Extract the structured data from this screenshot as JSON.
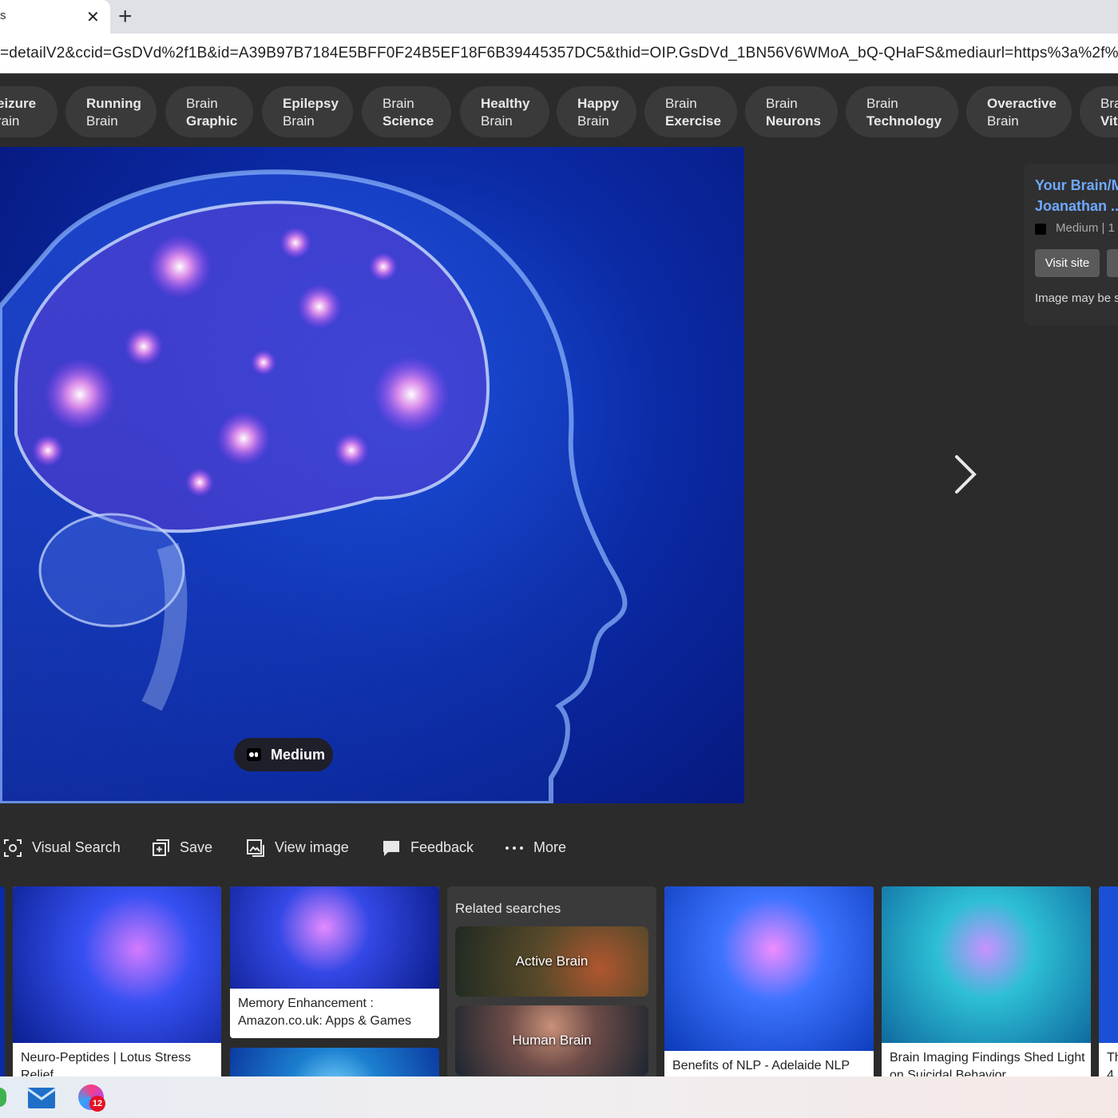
{
  "browser": {
    "tab_title": "s",
    "tab_close": "✕",
    "new_tab": "+",
    "url": "=detailV2&ccid=GsDVd%2f1B&id=A39B97B7184E5BFF0F24B5EF18F6B39445357DC5&thid=OIP.GsDVd_1BN56V6WMoA_bQ-QHaFS&mediaurl=https%3a%2f%2fmiro.medium.co"
  },
  "chips": [
    {
      "line1": "eizure",
      "line2": "rain",
      "bold": "line1"
    },
    {
      "line1": "Running",
      "line2": "Brain",
      "bold": "line1"
    },
    {
      "line1": "Brain",
      "line2": "Graphic",
      "bold": "line2"
    },
    {
      "line1": "Epilepsy",
      "line2": "Brain",
      "bold": "line1"
    },
    {
      "line1": "Brain",
      "line2": "Science",
      "bold": "line2"
    },
    {
      "line1": "Healthy",
      "line2": "Brain",
      "bold": "line1"
    },
    {
      "line1": "Happy",
      "line2": "Brain",
      "bold": "line1"
    },
    {
      "line1": "Brain",
      "line2": "Exercise",
      "bold": "line2"
    },
    {
      "line1": "Brain",
      "line2": "Neurons",
      "bold": "line2"
    },
    {
      "line1": "Brain",
      "line2": "Technology",
      "bold": "line2"
    },
    {
      "line1": "Overactive",
      "line2": "Brain",
      "bold": "line1"
    },
    {
      "line1": "Bra",
      "line2": "Vit",
      "bold": "line2"
    }
  ],
  "main": {
    "source_label": "Medium"
  },
  "info": {
    "title_line1": "Your Brain/M",
    "title_line2": "Joanathan ...",
    "source": "Medium   |   1",
    "visit_label": "Visit site",
    "note": "Image may be su"
  },
  "actions": [
    {
      "label": "Visual Search",
      "icon": "visual-search-icon"
    },
    {
      "label": "Save",
      "icon": "save-icon"
    },
    {
      "label": "View image",
      "icon": "view-image-icon"
    },
    {
      "label": "Feedback",
      "icon": "feedback-icon"
    },
    {
      "label": "More",
      "icon": "more-icon"
    }
  ],
  "thumbs": [
    {
      "caption_line1": "Neuro-Peptides | Lotus Stress",
      "caption_line2": "Relief"
    },
    {
      "caption_line1": "Memory Enhancement :",
      "caption_line2": "Amazon.co.uk: Apps & Games"
    },
    {
      "caption_line1": "Benefits of NLP - Adelaide NLP",
      "caption_line2": ""
    },
    {
      "caption_line1": "Brain Imaging Findings Shed Light",
      "caption_line2": "on Suicidal Behavior"
    },
    {
      "caption_line1": "Th",
      "caption_line2": "4"
    }
  ],
  "related": {
    "title": "Related searches",
    "items": [
      "Active Brain",
      "Human Brain"
    ]
  },
  "taskbar": {
    "badge": "12"
  },
  "colors": {
    "background": "#2b2b2b",
    "chip": "#3a3a3a",
    "link": "#6fa8ff",
    "image_blue": "#0b2aa5"
  }
}
